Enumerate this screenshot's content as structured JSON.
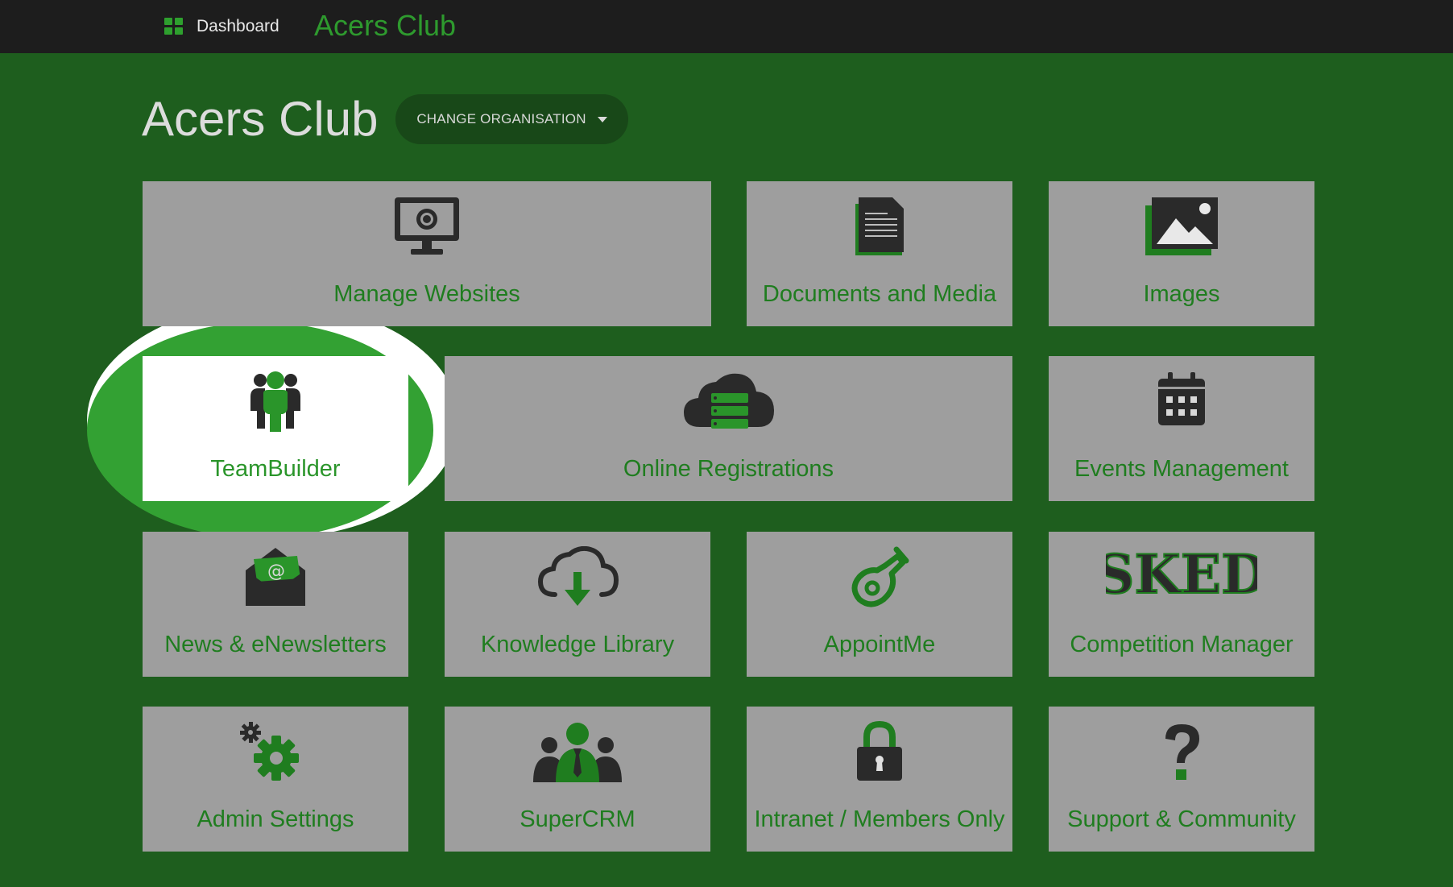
{
  "topbar": {
    "dashboard_label": "Dashboard",
    "brand": "Acers Club"
  },
  "header": {
    "title": "Acers Club",
    "change_org_label": "CHANGE ORGANISATION"
  },
  "tiles": [
    {
      "label": "Manage Websites",
      "icon": "monitor-icon"
    },
    {
      "label": "Documents and Media",
      "icon": "document-icon"
    },
    {
      "label": "Images",
      "icon": "image-icon"
    },
    {
      "label": "TeamBuilder",
      "icon": "team-icon"
    },
    {
      "label": "Online Registrations",
      "icon": "cloud-database-icon"
    },
    {
      "label": "Events Management",
      "icon": "calendar-icon"
    },
    {
      "label": "News & eNewsletters",
      "icon": "envelope-icon"
    },
    {
      "label": "Knowledge Library",
      "icon": "cloud-download-icon"
    },
    {
      "label": "AppointMe",
      "icon": "whistle-icon"
    },
    {
      "label": "Competition Manager",
      "icon": "sked-logo",
      "logo_text": "SKED"
    },
    {
      "label": "Admin Settings",
      "icon": "gears-icon"
    },
    {
      "label": "SuperCRM",
      "icon": "people-icon"
    },
    {
      "label": "Intranet / Members Only",
      "icon": "lock-icon"
    },
    {
      "label": "Support & Community",
      "icon": "question-icon"
    }
  ],
  "colors": {
    "page_bg": "#1e5e1e",
    "topbar_bg": "#1d1d1d",
    "tile_bg": "#9e9e9e",
    "accent": "#2e9a2e",
    "highlight": "#33a133",
    "icon_dark": "#2a2a2a"
  }
}
